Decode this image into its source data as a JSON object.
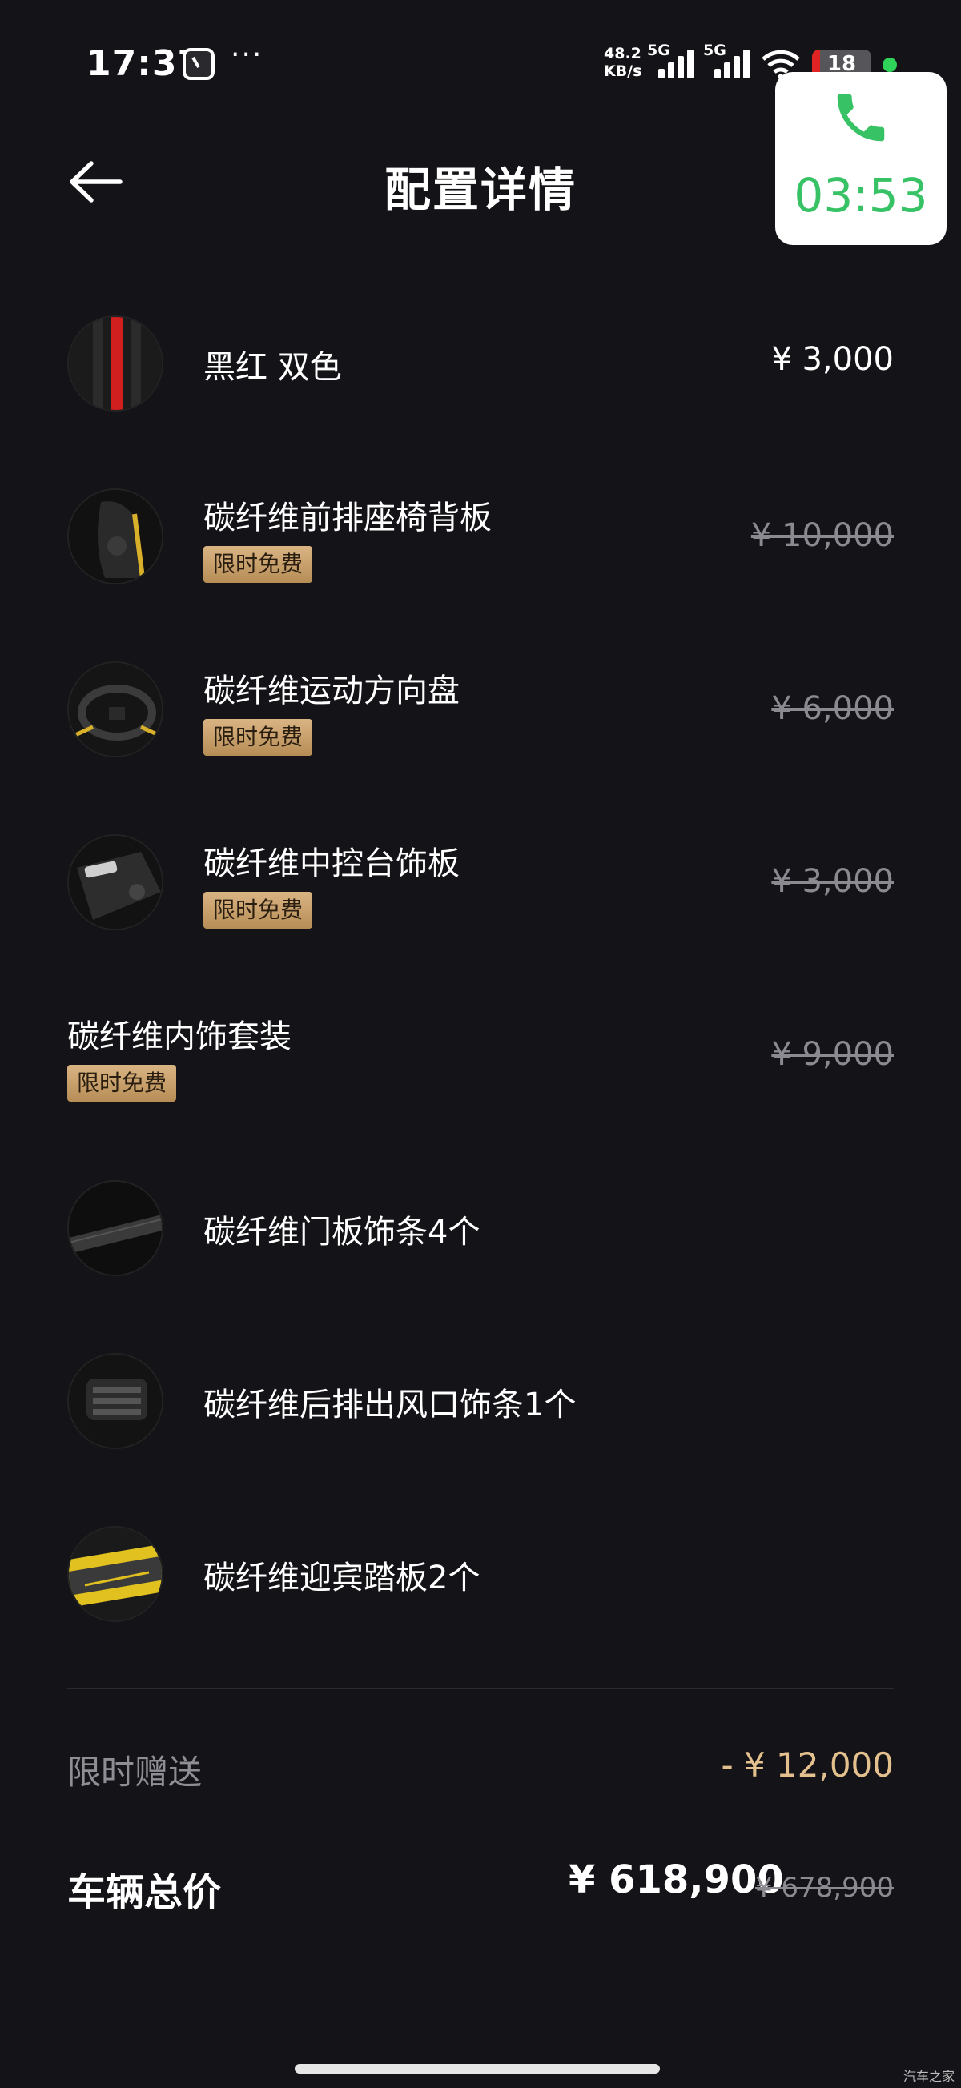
{
  "status_bar": {
    "time": "17:37",
    "more": "···",
    "speed_top": "48.2",
    "speed_bottom": "KB/s",
    "net1": "5G",
    "net2": "5G",
    "battery": "18"
  },
  "call_overlay": {
    "timer": "03:53",
    "accent": "#38c266"
  },
  "header": {
    "title": "配置详情"
  },
  "items": [
    {
      "name": "黑红 双色",
      "price": "¥ 3,000",
      "struck": false,
      "badge": ""
    },
    {
      "name": "碳纤维前排座椅背板",
      "price": "¥ 10,000",
      "struck": true,
      "badge": "限时免费"
    },
    {
      "name": "碳纤维运动方向盘",
      "price": "¥ 6,000",
      "struck": true,
      "badge": "限时免费"
    },
    {
      "name": "碳纤维中控台饰板",
      "price": "¥ 3,000",
      "struck": true,
      "badge": "限时免费"
    },
    {
      "name": "碳纤维内饰套装",
      "price": "¥ 9,000",
      "struck": true,
      "badge": "限时免费"
    },
    {
      "name": "碳纤维门板饰条4个",
      "price": "",
      "struck": false,
      "badge": ""
    },
    {
      "name": "碳纤维后排出风口饰条1个",
      "price": "",
      "struck": false,
      "badge": ""
    },
    {
      "name": "碳纤维迎宾踏板2个",
      "price": "",
      "struck": false,
      "badge": ""
    }
  ],
  "summary": {
    "gift_label": "限时赠送",
    "gift_value": "- ¥ 12,000",
    "total_label": "车辆总价",
    "total_value": "¥ 618,900",
    "total_original": "¥ 678,900"
  },
  "colors": {
    "background": "#131318",
    "badge": "#c9a06a",
    "gift": "#e3c08d"
  },
  "watermark": "汽车之家"
}
